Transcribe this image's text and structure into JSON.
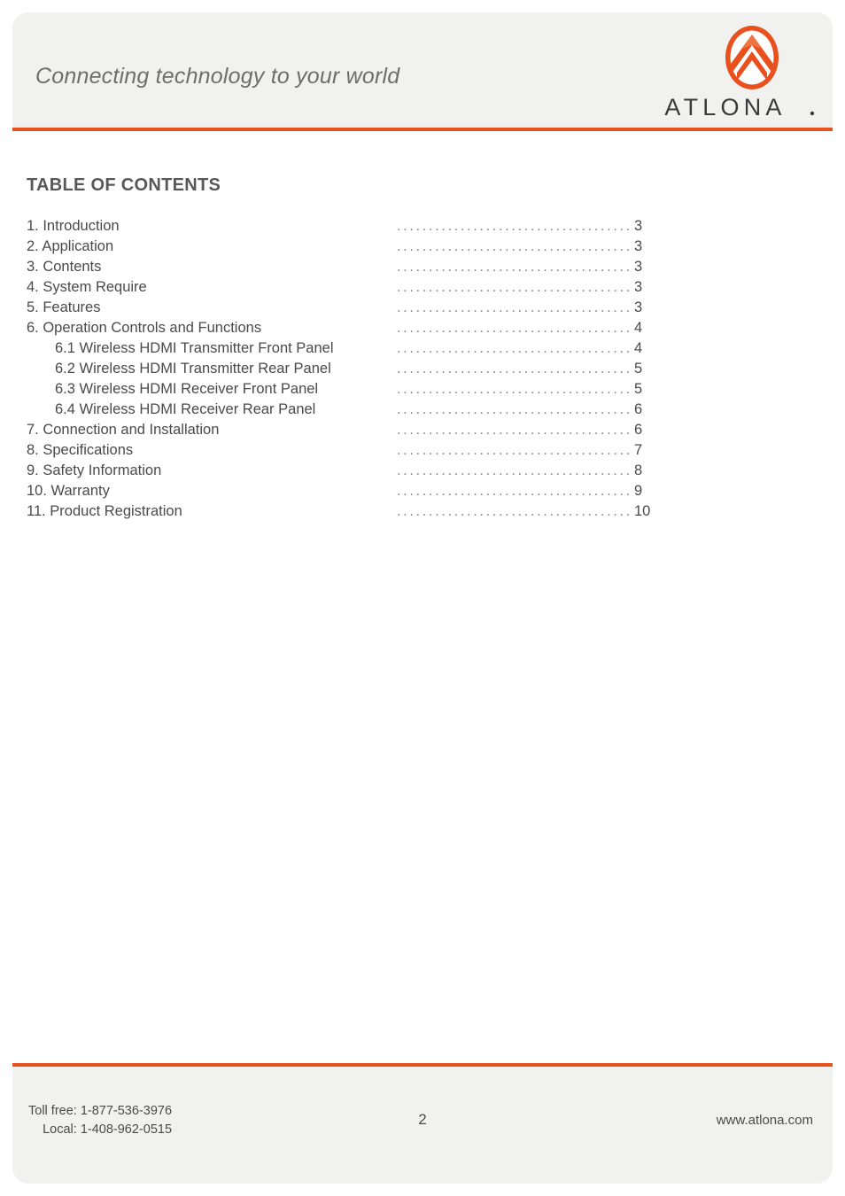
{
  "header": {
    "tagline": "Connecting technology to your world",
    "brand_name": "ATLONA",
    "brand_mark_icon": "atlona-chevron-logo-icon",
    "accent_color": "#e8501e",
    "band_color": "#f1f1ef"
  },
  "main": {
    "heading": "TABLE OF CONTENTS",
    "leader_dots": "......................................................",
    "entries": [
      {
        "label": "1. Introduction",
        "page": "3",
        "level": 0
      },
      {
        "label": "2. Application",
        "page": "3",
        "level": 0
      },
      {
        "label": "3. Contents",
        "page": "3",
        "level": 0
      },
      {
        "label": "4. System Require",
        "page": "3",
        "level": 0
      },
      {
        "label": "5. Features",
        "page": "3",
        "level": 0
      },
      {
        "label": "6. Operation Controls and Functions",
        "page": "4",
        "level": 0
      },
      {
        "label": "6.1 Wireless HDMI Transmitter Front Panel",
        "page": "4",
        "level": 1
      },
      {
        "label": "6.2 Wireless HDMI Transmitter Rear Panel",
        "page": "5",
        "level": 1
      },
      {
        "label": "6.3 Wireless HDMI Receiver Front Panel",
        "page": "5",
        "level": 1
      },
      {
        "label": "6.4 Wireless HDMI Receiver Rear Panel",
        "page": "6",
        "level": 1
      },
      {
        "label": "7. Connection and Installation",
        "page": "6",
        "level": 0
      },
      {
        "label": "8. Specifications",
        "page": "7",
        "level": 0
      },
      {
        "label": "9. Safety Information",
        "page": "8",
        "level": 0
      },
      {
        "label": "10. Warranty",
        "page": "9",
        "level": 0
      },
      {
        "label": "11. Product Registration",
        "page": "10",
        "level": 0
      }
    ]
  },
  "footer": {
    "toll_free": "Toll free: 1-877-536-3976",
    "local": "Local: 1-408-962-0515",
    "page_number": "2",
    "website": "www.atlona.com"
  }
}
